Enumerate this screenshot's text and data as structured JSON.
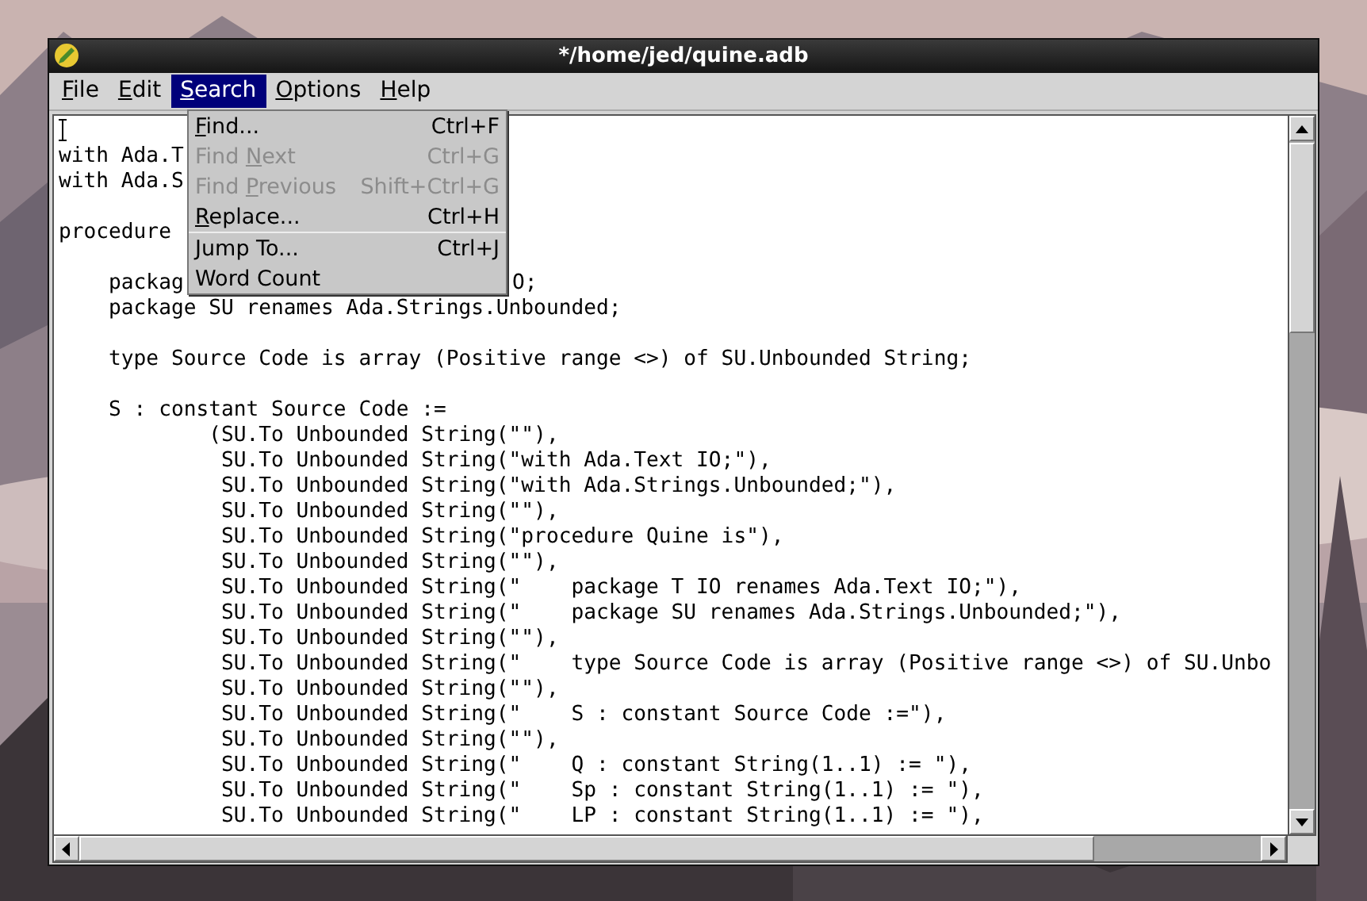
{
  "window": {
    "title": "*/home/jed/quine.adb"
  },
  "menubar": [
    {
      "key": "F",
      "post": "ile",
      "selected": false
    },
    {
      "key": "E",
      "post": "dit",
      "selected": false
    },
    {
      "key": "S",
      "post": "earch",
      "selected": true
    },
    {
      "key": "O",
      "post": "ptions",
      "selected": false
    },
    {
      "key": "H",
      "post": "elp",
      "selected": false
    }
  ],
  "search_menu": {
    "items": [
      {
        "key": "F",
        "post": "ind...",
        "shortcut": "Ctrl+F",
        "disabled": false,
        "separator_after": false
      },
      {
        "pre": "Find ",
        "key": "N",
        "post": "ext",
        "shortcut": "Ctrl+G",
        "disabled": true,
        "separator_after": false
      },
      {
        "pre": "Find ",
        "key": "P",
        "post": "revious",
        "shortcut": "Shift+Ctrl+G",
        "disabled": true,
        "separator_after": false
      },
      {
        "key": "R",
        "post": "eplace...",
        "shortcut": "Ctrl+H",
        "disabled": false,
        "separator_after": true
      },
      {
        "key": "J",
        "post": "ump To...",
        "shortcut": "Ctrl+J",
        "disabled": false,
        "separator_after": false
      },
      {
        "pre": "Word Count",
        "disabled": false,
        "separator_after": false
      }
    ]
  },
  "editor": {
    "blocks": [
      {
        "lines": [
          {
            "text": "with Ada.T"
          },
          {
            "text": "with Ada.S"
          }
        ]
      },
      {
        "lines": [
          {
            "text": "procedure"
          }
        ]
      },
      {
        "lines": [
          {
            "text": "    packag",
            "tail": "O;"
          },
          {
            "text": "    package SU renames Ada.Strings.Unbounded;"
          }
        ]
      },
      {
        "lines": [
          {
            "text": "    type Source Code is array (Positive range <>) of SU.Unbounded String;"
          }
        ]
      },
      {
        "lines": [
          {
            "text": "    S : constant Source Code :="
          },
          {
            "text": "            (SU.To Unbounded String(\"\"),"
          },
          {
            "text": "             SU.To Unbounded String(\"with Ada.Text IO;\"),"
          },
          {
            "text": "             SU.To Unbounded String(\"with Ada.Strings.Unbounded;\"),"
          },
          {
            "text": "             SU.To Unbounded String(\"\"),"
          },
          {
            "text": "             SU.To Unbounded String(\"procedure Quine is\"),"
          },
          {
            "text": "             SU.To Unbounded String(\"\"),"
          },
          {
            "text": "             SU.To Unbounded String(\"    package T IO renames Ada.Text IO;\"),"
          },
          {
            "text": "             SU.To Unbounded String(\"    package SU renames Ada.Strings.Unbounded;\"),"
          },
          {
            "text": "             SU.To Unbounded String(\"\"),"
          },
          {
            "text": "             SU.To Unbounded String(\"    type Source Code is array (Positive range <>) of SU.Unbo"
          },
          {
            "text": "             SU.To Unbounded String(\"\"),"
          },
          {
            "text": "             SU.To Unbounded String(\"    S : constant Source Code :=\"),"
          },
          {
            "text": "             SU.To Unbounded String(\"\"),"
          },
          {
            "text": "             SU.To Unbounded String(\"    Q : constant String(1..1) := \"),"
          },
          {
            "text": "             SU.To Unbounded String(\"    Sp : constant String(1..1) := \"),"
          },
          {
            "text": "             SU.To Unbounded String(\"    LP : constant String(1..1) := \"),"
          }
        ]
      }
    ]
  }
}
